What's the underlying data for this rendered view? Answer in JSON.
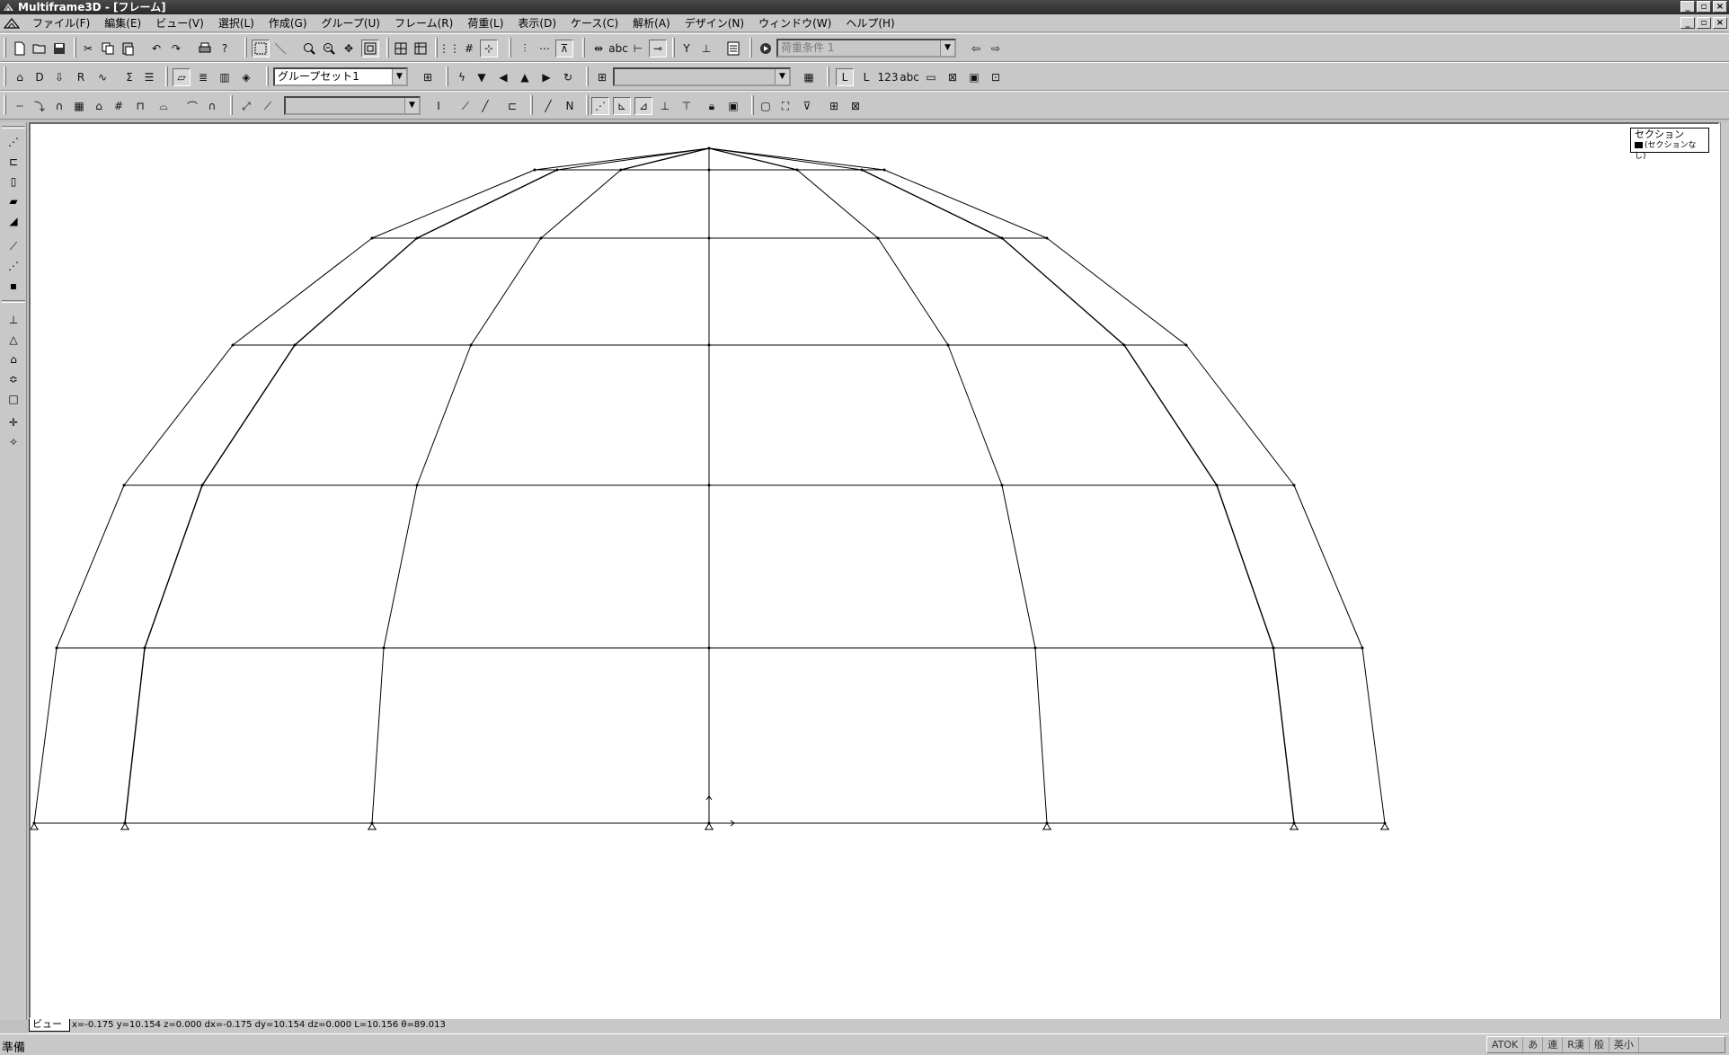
{
  "window": {
    "title": "Multiframe3D - [フレーム]",
    "controls": [
      "_",
      "▫",
      "×"
    ]
  },
  "menu": {
    "items": [
      "ファイル(F)",
      "編集(E)",
      "ビュー(V)",
      "選択(L)",
      "作成(G)",
      "グループ(U)",
      "フレーム(R)",
      "荷重(L)",
      "表示(D)",
      "ケース(C)",
      "解析(A)",
      "デザイン(N)",
      "ウィンドウ(W)",
      "ヘルプ(H)"
    ]
  },
  "toolbar1": {
    "load_case_combo": "荷重条件 1"
  },
  "toolbar2": {
    "group_set_combo": "グループセット1",
    "second_combo": ""
  },
  "toolbar3": {
    "section_combo": ""
  },
  "legend": {
    "title": "セクション",
    "entry": "(セクションなし)"
  },
  "view_tab": "ビュー",
  "coordinates": "x=-0.175 y=10.154 z=0.000 dx=-0.175 dy=10.154 dz=0.000 L=10.156 θ=89.013",
  "status": {
    "ready": "準備",
    "ime_items": [
      "ATOK",
      "あ",
      "連",
      "R漢",
      "般",
      "英小"
    ]
  },
  "colors": {
    "titlebar": "#3a3a3a",
    "chrome": "#c8c8c8",
    "canvas": "#ffffff",
    "frame_line": "#000000"
  }
}
